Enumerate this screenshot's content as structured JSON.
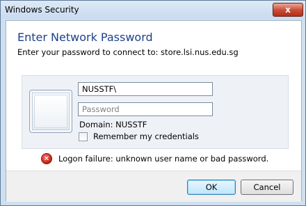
{
  "window": {
    "title": "Windows Security",
    "close_glyph": "x"
  },
  "dialog": {
    "heading": "Enter Network Password",
    "subtitle": "Enter your password to connect to: store.lsi.nus.edu.sg"
  },
  "credentials": {
    "username_value": "NUSSTF\\",
    "password_value": "",
    "password_placeholder": "Password",
    "domain_text": "Domain: NUSSTF",
    "remember_label": "Remember my credentials",
    "remember_checked": false
  },
  "error": {
    "message": "Logon failure: unknown user name or bad password.",
    "icon": "error-x-icon",
    "icon_glyph": "✕",
    "color": "#c01f15"
  },
  "buttons": {
    "ok_label": "OK",
    "cancel_label": "Cancel"
  },
  "colors": {
    "heading": "#1e3f8a",
    "close_button": "#c94a33",
    "frame": "#cfdff0"
  }
}
